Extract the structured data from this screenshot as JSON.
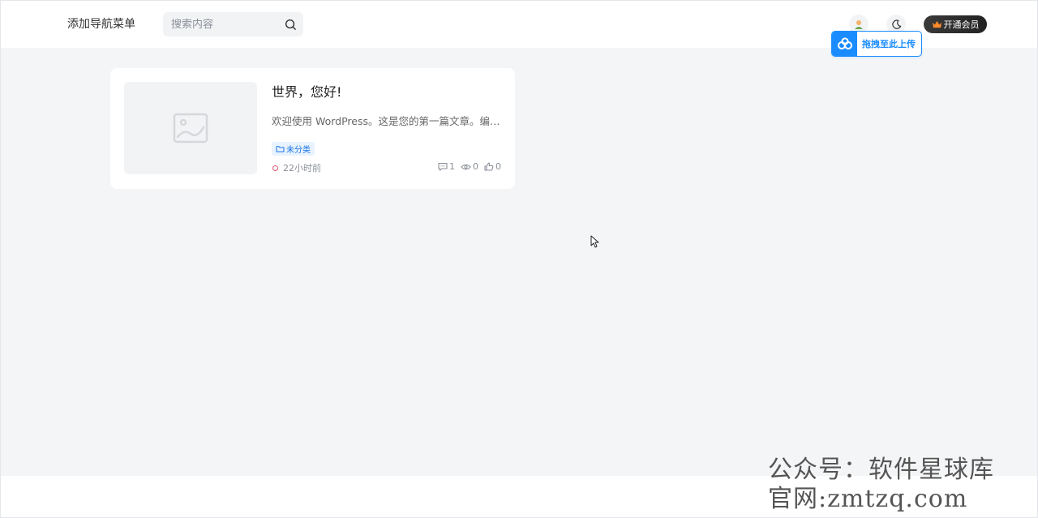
{
  "header": {
    "nav_label": "添加导航菜单",
    "search_placeholder": "搜索内容",
    "vip_label": "开通会员",
    "upload_label": "拖拽至此上传"
  },
  "post": {
    "title": "世界，您好!",
    "excerpt": "欢迎使用 WordPress。这是您的第一篇文章。编辑…",
    "category": "未分类",
    "time": "22小时前",
    "comments": "1",
    "views": "0",
    "likes": "0"
  },
  "watermark": {
    "line1": "公众号：软件星球库",
    "line2": "官网:zmtzq.com"
  },
  "colors": {
    "accent": "#1a8cff",
    "background": "#f4f5f7",
    "tag_bg": "#e8f3ff",
    "time_dot": "#e4576d"
  }
}
